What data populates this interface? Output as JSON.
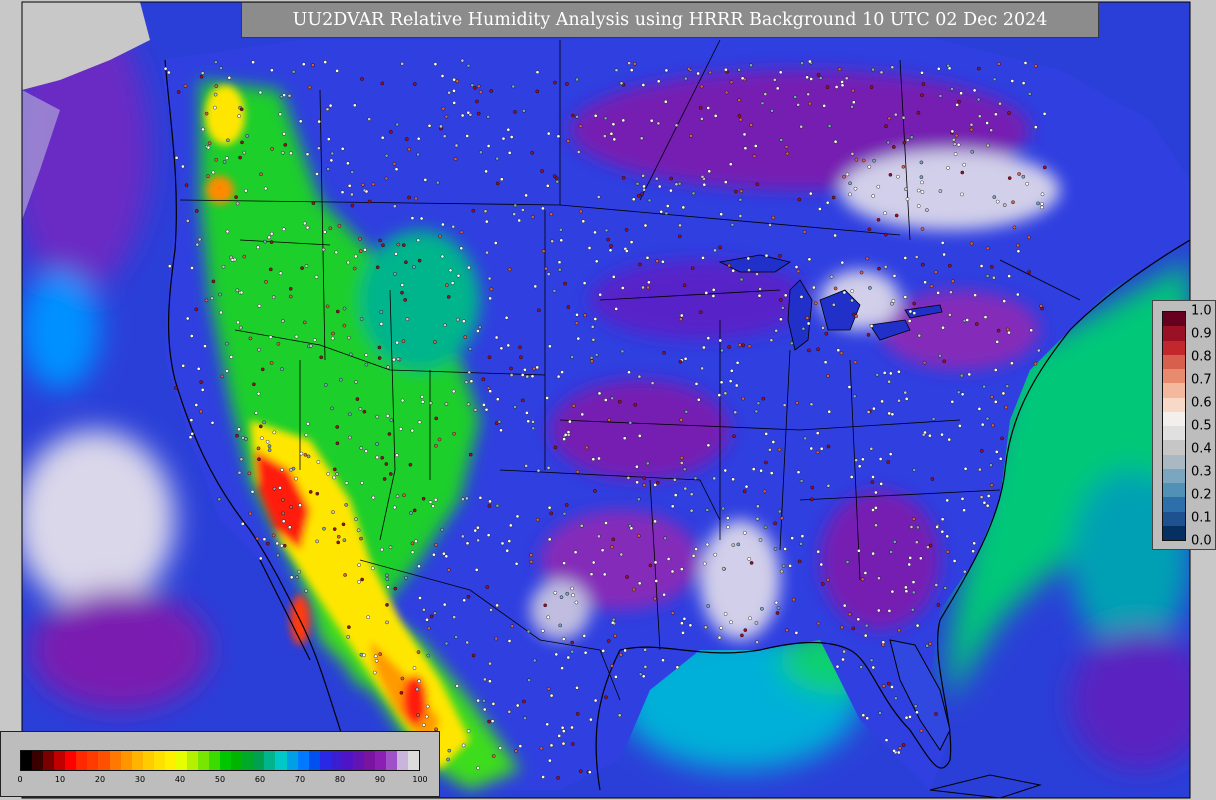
{
  "title": "UU2DVAR Relative Humidity Analysis using HRRR Background 10 UTC 02 Dec 2024",
  "colors": {
    "frame_bg": "#c8c8c8",
    "ocean_base": "#2a3fd8",
    "land_blue": "#2f3fe0",
    "purple": "#7a1fb0",
    "white_high": "#dad7ea",
    "dry_red": "#ff1a10",
    "dry_orange": "#ff9a00",
    "dry_yellow": "#ffe600",
    "green": "#1fcf2a",
    "teal": "#00c896",
    "gulf_cyan": "#00c0c8",
    "land_grey": "#c8c8c8",
    "borders": "#000000",
    "station_fill": "#ffffff"
  },
  "colorbar_main": {
    "ticks": [
      "0",
      "10",
      "20",
      "30",
      "40",
      "50",
      "60",
      "70",
      "80",
      "90",
      "100"
    ],
    "colors": [
      "#000000",
      "#3a0000",
      "#7a0000",
      "#c00000",
      "#ff0000",
      "#ff2800",
      "#ff3c00",
      "#ff5000",
      "#ff7800",
      "#ff9600",
      "#ffb400",
      "#ffcc00",
      "#ffe100",
      "#fff000",
      "#e6ff00",
      "#b4f000",
      "#78e600",
      "#3cdc00",
      "#00c800",
      "#00b400",
      "#00aa28",
      "#00a050",
      "#00b48c",
      "#00c8c8",
      "#00a0e6",
      "#0078ff",
      "#0050f0",
      "#2828e6",
      "#3c1ed2",
      "#5014c8",
      "#6414b4",
      "#7814a0",
      "#8c1eb4",
      "#a050c8",
      "#c8b4dc",
      "#dcdcdc"
    ]
  },
  "colorbar_right": {
    "ticks": [
      "1.0",
      "0.9",
      "0.8",
      "0.7",
      "0.6",
      "0.5",
      "0.4",
      "0.3",
      "0.2",
      "0.1",
      "0.0"
    ],
    "colors": [
      "#67001f",
      "#9a1024",
      "#c2272d",
      "#d6604d",
      "#e78a6e",
      "#f4b89c",
      "#f8d9c8",
      "#f2efec",
      "#e0e0e0",
      "#c6c6c6",
      "#a9b8c2",
      "#7aa6bf",
      "#5291b6",
      "#2d6fa8",
      "#1d5190",
      "#053061"
    ]
  }
}
